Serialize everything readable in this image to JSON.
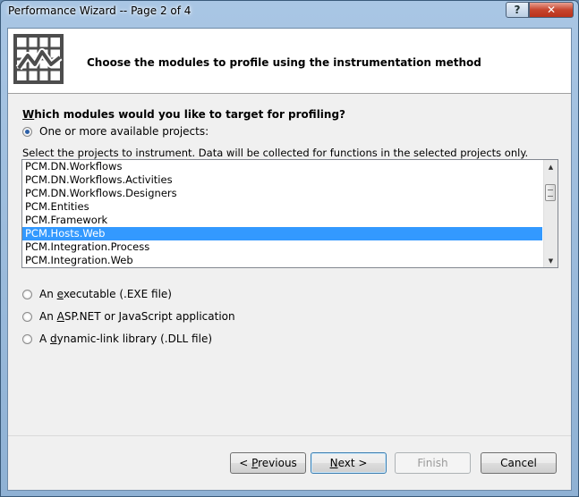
{
  "window": {
    "title": "Performance Wizard -- Page 2 of 4",
    "help_label": "?",
    "close_label": "✕"
  },
  "header": {
    "title": "Choose the modules to profile using the instrumentation method"
  },
  "question": {
    "prefix": "W",
    "rest": "hich modules would you like to target for profiling?"
  },
  "options": {
    "projects": {
      "label": "One or more available projects:",
      "checked": true
    },
    "instructions": "Select the projects to instrument.  Data will be collected for functions in the selected projects only.",
    "executable": {
      "pre": "An ",
      "key": "e",
      "post": "xecutable (.EXE file)"
    },
    "aspnet": {
      "pre": "An ",
      "key": "A",
      "post": "SP.NET or JavaScript application"
    },
    "dll": {
      "pre": "A ",
      "key": "d",
      "post": "ynamic-link library (.DLL file)"
    }
  },
  "projects_list": [
    "PCM.DN.Workflows",
    "PCM.DN.Workflows.Activities",
    "PCM.DN.Workflows.Designers",
    "PCM.Entities",
    "PCM.Framework",
    "PCM.Hosts.Web",
    "PCM.Integration.Process",
    "PCM.Integration.Web"
  ],
  "selected_project": "PCM.Hosts.Web",
  "buttons": {
    "previous": {
      "pre": "< ",
      "key": "P",
      "post": "revious"
    },
    "next": {
      "pre": "",
      "key": "N",
      "post": "ext >"
    },
    "finish": "Finish",
    "cancel": "Cancel"
  },
  "colors": {
    "selection": "#3399ff",
    "close_button": "#c7452e"
  },
  "icons": {
    "header": "performance-chart-icon",
    "scroll_up": "scroll-up-arrow-icon",
    "scroll_down": "scroll-down-arrow-icon"
  }
}
